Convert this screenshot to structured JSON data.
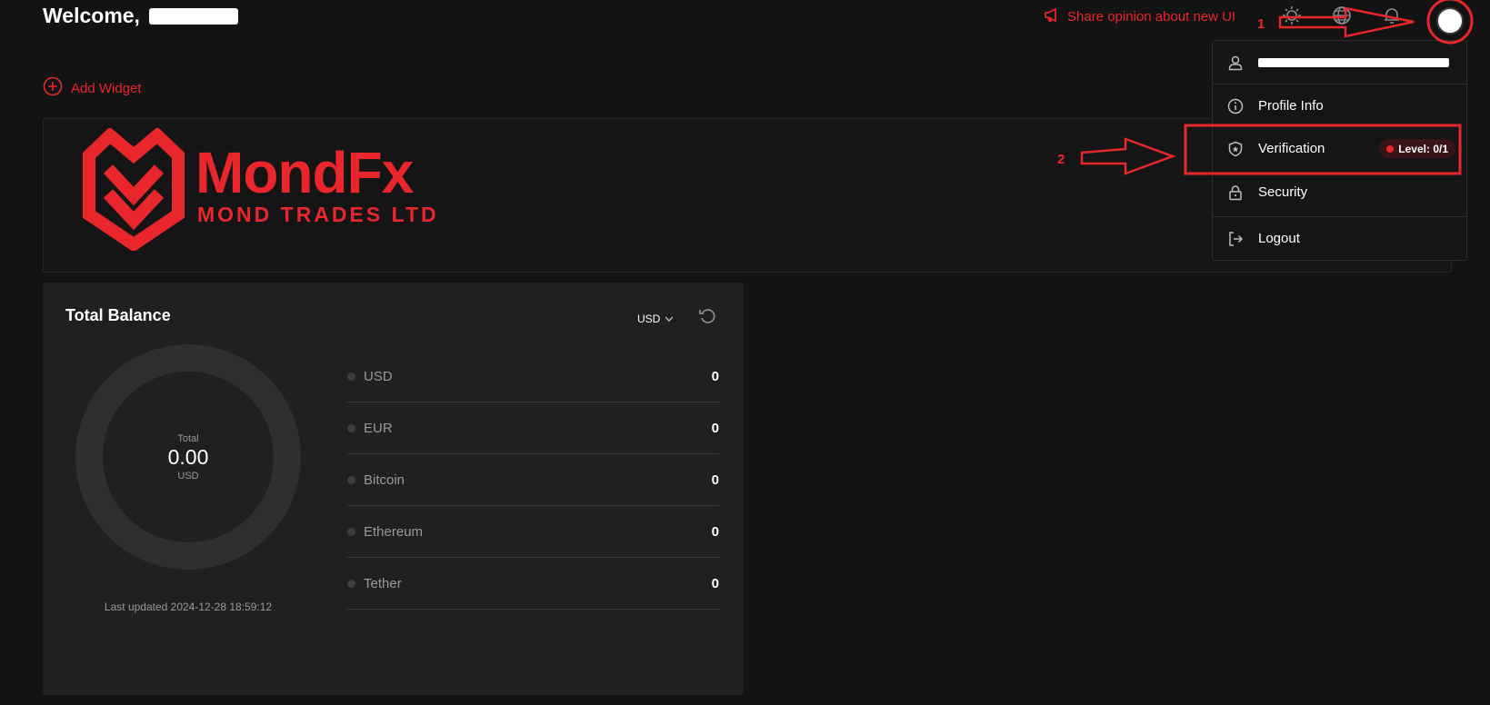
{
  "header": {
    "welcome_label": "Welcome,",
    "share_label": "Share opinion about new UI",
    "icons": [
      "theme-icon",
      "globe-icon",
      "bell-icon",
      "avatar"
    ]
  },
  "add_widget_label": "Add Widget",
  "brand": {
    "name": "MondFx",
    "subtitle": "MOND TRADES LTD",
    "color": "#e8262b"
  },
  "balance": {
    "title": "Total Balance",
    "currency": "USD",
    "donut": {
      "label": "Total",
      "value": "0.00",
      "unit": "USD"
    },
    "last_updated": "Last updated 2024-12-28 18:59:12",
    "assets": [
      {
        "name": "USD",
        "value": "0"
      },
      {
        "name": "EUR",
        "value": "0"
      },
      {
        "name": "Bitcoin",
        "value": "0"
      },
      {
        "name": "Ethereum",
        "value": "0"
      },
      {
        "name": "Tether",
        "value": "0"
      }
    ]
  },
  "menu": {
    "items": [
      {
        "label": "Profile Info",
        "icon": "info-icon"
      },
      {
        "label": "Verification",
        "icon": "shield-icon",
        "badge": "Level: 0/1"
      },
      {
        "label": "Security",
        "icon": "lock-icon"
      },
      {
        "label": "Logout",
        "icon": "logout-icon"
      }
    ]
  },
  "annotations": {
    "step1": "1",
    "step2": "2"
  }
}
